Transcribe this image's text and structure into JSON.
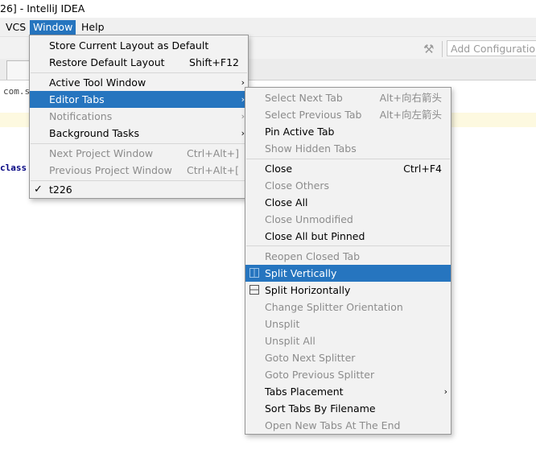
{
  "window": {
    "title": "26] - IntelliJ IDEA"
  },
  "menubar": {
    "vcs": "VCS",
    "window": "Window",
    "help": "Help"
  },
  "toolbar": {
    "config_placeholder": "Add Configuration..."
  },
  "editor": {
    "package_line": "com.s",
    "class_line": "class"
  },
  "window_menu": {
    "store_layout": "Store Current Layout as Default",
    "restore_layout": "Restore Default Layout",
    "restore_layout_shortcut": "Shift+F12",
    "active_tool_window": "Active Tool Window",
    "editor_tabs": "Editor Tabs",
    "notifications": "Notifications",
    "background_tasks": "Background Tasks",
    "next_project_window": "Next Project Window",
    "next_project_window_shortcut": "Ctrl+Alt+]",
    "previous_project_window": "Previous Project Window",
    "previous_project_window_shortcut": "Ctrl+Alt+[",
    "project": "t226"
  },
  "editor_tabs_menu": {
    "select_next_tab": "Select Next Tab",
    "select_next_tab_shortcut": "Alt+向右箭头",
    "select_previous_tab": "Select Previous Tab",
    "select_previous_tab_shortcut": "Alt+向左箭头",
    "pin_active_tab": "Pin Active Tab",
    "show_hidden_tabs": "Show Hidden Tabs",
    "close": "Close",
    "close_shortcut": "Ctrl+F4",
    "close_others": "Close Others",
    "close_all": "Close All",
    "close_unmodified": "Close Unmodified",
    "close_all_but_pinned": "Close All but Pinned",
    "reopen_closed_tab": "Reopen Closed Tab",
    "split_vertically": "Split Vertically",
    "split_horizontally": "Split Horizontally",
    "change_splitter_orientation": "Change Splitter Orientation",
    "unsplit": "Unsplit",
    "unsplit_all": "Unsplit All",
    "goto_next_splitter": "Goto Next Splitter",
    "goto_previous_splitter": "Goto Previous Splitter",
    "tabs_placement": "Tabs Placement",
    "sort_tabs_by_filename": "Sort Tabs By Filename",
    "open_new_tabs_at_end": "Open New Tabs At The End"
  },
  "icons": {
    "submenu_arrow": "chevron-right-icon",
    "check": "checkmark-icon",
    "build": "hammer-icon",
    "split_vertically": "split-vertically-icon",
    "split_horizontally": "split-horizontally-icon"
  },
  "colors": {
    "selection": "#2675bf",
    "menu_background": "#f2f2f2",
    "disabled_text": "#8c8c8c"
  }
}
